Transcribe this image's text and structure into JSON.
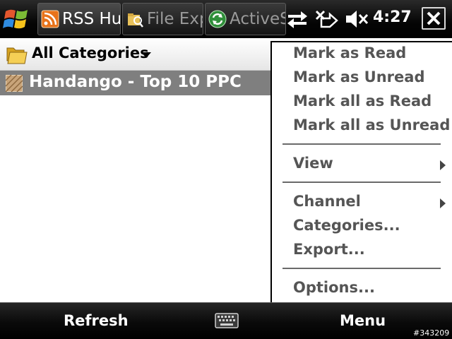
{
  "taskbar": {
    "tabs": [
      {
        "label": "RSS Hub",
        "icon": "rss-icon",
        "active": true
      },
      {
        "label": "File Explorer",
        "icon": "file-explorer-icon",
        "active": false
      },
      {
        "label": "ActiveSync",
        "icon": "activesync-icon",
        "active": false
      }
    ],
    "clock": "4:27",
    "status_icons": [
      "connectivity-icon",
      "no-signal-icon",
      "speaker-muted-icon"
    ]
  },
  "category": {
    "label": "All Categories"
  },
  "feeds": [
    {
      "title": "Handango - Top 10 PPC",
      "selected": true
    }
  ],
  "menu": {
    "groups": [
      [
        {
          "label": "Mark as Read"
        },
        {
          "label": "Mark as Unread"
        },
        {
          "label": "Mark all as Read"
        },
        {
          "label": "Mark all as Unread"
        }
      ],
      [
        {
          "label": "View",
          "submenu": true
        }
      ],
      [
        {
          "label": "Channel",
          "submenu": true
        },
        {
          "label": "Categories..."
        },
        {
          "label": "Export..."
        }
      ],
      [
        {
          "label": "Options..."
        }
      ]
    ]
  },
  "softkeys": {
    "left": "Refresh",
    "right": "Menu",
    "center_icon": "keyboard-icon"
  },
  "watermark": "#343209",
  "colors": {
    "selected_row": "#7f7f7f",
    "menu_text": "#555555",
    "bar_dark": "#000000"
  }
}
